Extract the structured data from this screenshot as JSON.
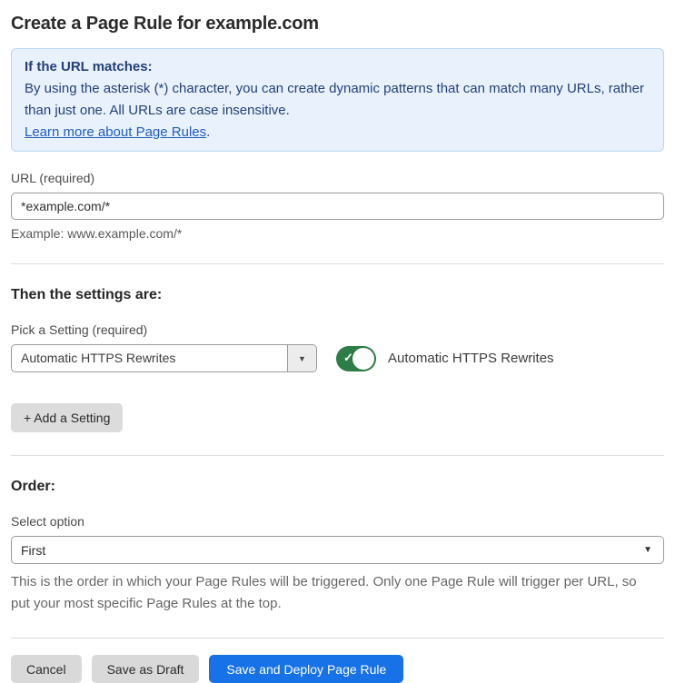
{
  "page": {
    "title": "Create a Page Rule for example.com"
  },
  "info_box": {
    "heading": "If the URL matches:",
    "body": "By using the asterisk (*) character, you can create dynamic patterns that can match many URLs, rather than just one. All URLs are case insensitive.",
    "link_label": "Learn more about Page Rules",
    "link_suffix": "."
  },
  "url_section": {
    "label": "URL (required)",
    "value": "*example.com/*",
    "example": "Example: www.example.com/*"
  },
  "settings_section": {
    "heading": "Then the settings are:",
    "picker_label": "Pick a Setting (required)",
    "selected_setting": "Automatic HTTPS Rewrites",
    "dropdown_arrow": "▼",
    "toggle_state": "on",
    "toggle_check": "✓",
    "toggle_label": "Automatic HTTPS Rewrites",
    "add_button_label": "+ Add a Setting"
  },
  "order_section": {
    "heading": "Order:",
    "label": "Select option",
    "selected_option": "First",
    "dropdown_arrow": "▼",
    "description": "This is the order in which your Page Rules will be triggered. Only one Page Rule will trigger per URL, so put your most specific Page Rules at the top."
  },
  "footer": {
    "cancel_label": "Cancel",
    "save_draft_label": "Save as Draft",
    "save_deploy_label": "Save and Deploy Page Rule"
  },
  "colors": {
    "accent_blue": "#1672e6",
    "toggle_green": "#2c7d46",
    "info_bg": "#e9f2fc",
    "info_border": "#b9d6f2",
    "info_text": "#24407a",
    "link_blue": "#1f5dc1"
  }
}
